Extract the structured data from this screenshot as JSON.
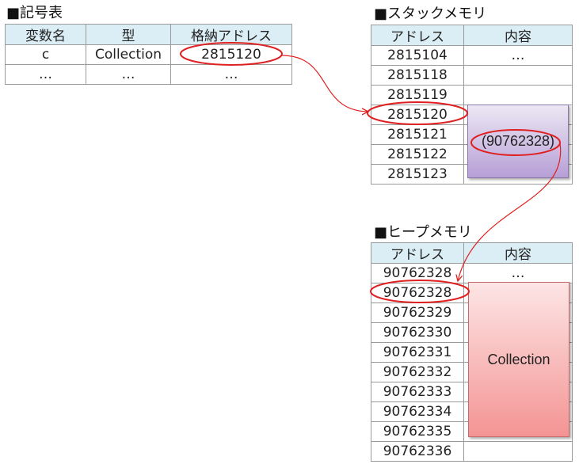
{
  "symbol_table": {
    "title": "■記号表",
    "headers": [
      "変数名",
      "型",
      "格納アドレス"
    ],
    "rows": [
      [
        "c",
        "Collection",
        "2815120"
      ],
      [
        "…",
        "…",
        "…"
      ]
    ]
  },
  "stack_memory": {
    "title": "■スタックメモリ",
    "headers": [
      "アドレス",
      "内容"
    ],
    "rows": [
      [
        "2815104",
        "…"
      ],
      [
        "2815118",
        ""
      ],
      [
        "2815119",
        ""
      ],
      [
        "2815120",
        ""
      ],
      [
        "2815121",
        ""
      ],
      [
        "2815122",
        ""
      ],
      [
        "2815123",
        ""
      ]
    ],
    "stored_value": "(90762328)"
  },
  "heap_memory": {
    "title": "■ヒープメモリ",
    "headers": [
      "アドレス",
      "内容"
    ],
    "rows": [
      [
        "90762328",
        "…"
      ],
      [
        "90762328",
        ""
      ],
      [
        "90762329",
        ""
      ],
      [
        "90762330",
        ""
      ],
      [
        "90762331",
        ""
      ],
      [
        "90762332",
        ""
      ],
      [
        "90762333",
        ""
      ],
      [
        "90762334",
        ""
      ],
      [
        "90762335",
        ""
      ],
      [
        "90762336",
        ""
      ]
    ],
    "object_label": "Collection"
  },
  "colors": {
    "header_fill": "#dbeef5",
    "highlight_ellipse": "#e02020",
    "stack_box_top": "#ece8f4",
    "stack_box_bottom": "#b79fd6",
    "heap_box_top": "#fde5e5",
    "heap_box_bottom": "#f49494"
  }
}
